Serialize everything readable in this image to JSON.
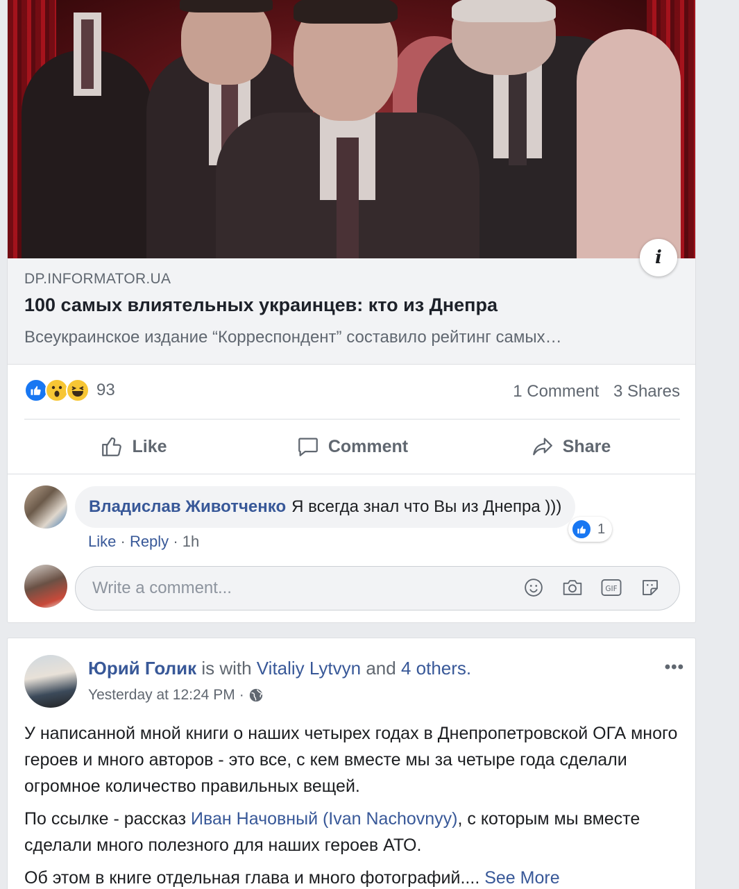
{
  "post1": {
    "link": {
      "domain": "DP.INFORMATOR.UA",
      "title": "100 самых влиятельных украинцев: кто из Днепра",
      "description": "Всеукраинское издание “Корреспондент” составило рейтинг самых…"
    },
    "info_button": "i",
    "stats": {
      "reaction_count": "93",
      "reactions": [
        "like",
        "wow",
        "haha"
      ],
      "comments": "1 Comment",
      "shares": "3 Shares"
    },
    "actions": {
      "like": "Like",
      "comment": "Comment",
      "share": "Share"
    },
    "comment": {
      "author": "Владислав Животченко",
      "text": "Я всегда знал что Вы из Днепра )))",
      "reaction_count": "1",
      "like": "Like",
      "reply": "Reply",
      "separator": "·",
      "time": "1h"
    },
    "write_comment": {
      "placeholder": "Write a comment..."
    }
  },
  "post2": {
    "author": "Юрий Голик",
    "with_text": "is with",
    "tagged": "Vitaliy Lytvyn",
    "and_text": "and",
    "others": "4 others.",
    "timestamp": "Yesterday at 12:24 PM",
    "separator": "·",
    "more": "•••",
    "paragraph1": "У написанной мной книги о наших четырех годах в Днепропетровской ОГА много героев и много авторов - это все, с кем вместе мы за четыре года сделали огромное количество правильных вещей.",
    "paragraph2_before": "По ссылке - рассказ",
    "paragraph2_link": "Иван Начовный (Ivan Nachovnyy)",
    "paragraph2_after": ", с которым мы вместе сделали много полезного для наших героев АТО.",
    "paragraph3": "Об этом в книге отдельная глава и много фотографий....",
    "see_more": "See More"
  },
  "colors": {
    "link_blue": "#385898",
    "secondary": "#606770",
    "like_blue": "#1877f2",
    "background": "#e9ebee"
  }
}
